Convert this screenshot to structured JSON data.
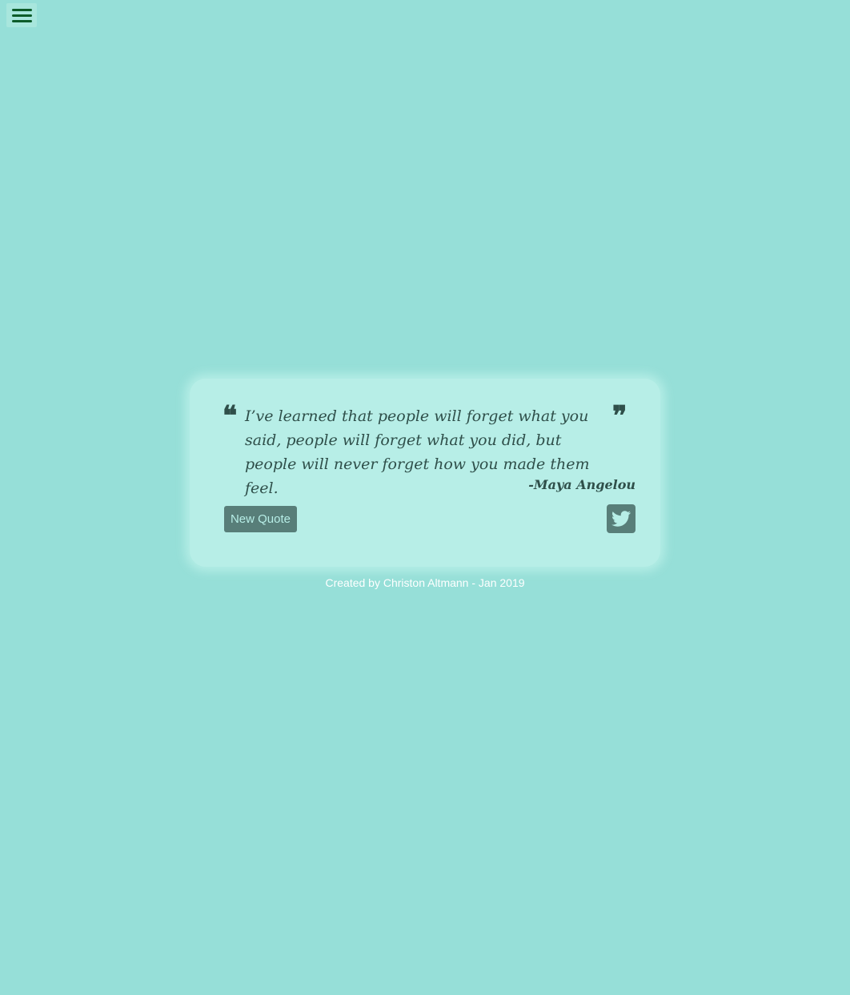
{
  "header": {
    "menu_icon": "hamburger-menu-icon"
  },
  "quote": {
    "open_mark": "❝",
    "close_mark": "❞",
    "text": "I’ve learned that people will forget what you said, people will forget what you did, but people will never forget how you made them feel.",
    "author": "-Maya Angelou"
  },
  "actions": {
    "new_quote_label": "New Quote",
    "tweet_icon": "twitter-icon"
  },
  "footer": {
    "credit": "Created by Christon Altmann - Jan 2019"
  },
  "colors": {
    "background": "#96dfd8",
    "card": "#b7eee7",
    "button": "#587e79",
    "text": "#2f4f4a",
    "menu_bars": "#0d5c2a"
  }
}
